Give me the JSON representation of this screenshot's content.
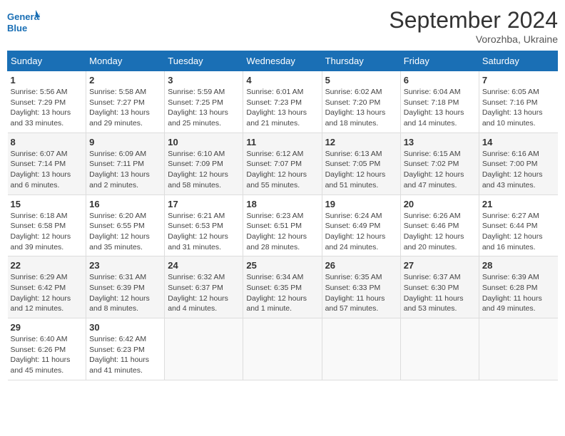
{
  "header": {
    "logo_line1": "General",
    "logo_line2": "Blue",
    "month": "September 2024",
    "location": "Vorozhba, Ukraine"
  },
  "weekdays": [
    "Sunday",
    "Monday",
    "Tuesday",
    "Wednesday",
    "Thursday",
    "Friday",
    "Saturday"
  ],
  "weeks": [
    [
      {
        "day": "1",
        "sunrise": "5:56 AM",
        "sunset": "7:29 PM",
        "daylight": "13 hours and 33 minutes."
      },
      {
        "day": "2",
        "sunrise": "5:58 AM",
        "sunset": "7:27 PM",
        "daylight": "13 hours and 29 minutes."
      },
      {
        "day": "3",
        "sunrise": "5:59 AM",
        "sunset": "7:25 PM",
        "daylight": "13 hours and 25 minutes."
      },
      {
        "day": "4",
        "sunrise": "6:01 AM",
        "sunset": "7:23 PM",
        "daylight": "13 hours and 21 minutes."
      },
      {
        "day": "5",
        "sunrise": "6:02 AM",
        "sunset": "7:20 PM",
        "daylight": "13 hours and 18 minutes."
      },
      {
        "day": "6",
        "sunrise": "6:04 AM",
        "sunset": "7:18 PM",
        "daylight": "13 hours and 14 minutes."
      },
      {
        "day": "7",
        "sunrise": "6:05 AM",
        "sunset": "7:16 PM",
        "daylight": "13 hours and 10 minutes."
      }
    ],
    [
      {
        "day": "8",
        "sunrise": "6:07 AM",
        "sunset": "7:14 PM",
        "daylight": "13 hours and 6 minutes."
      },
      {
        "day": "9",
        "sunrise": "6:09 AM",
        "sunset": "7:11 PM",
        "daylight": "13 hours and 2 minutes."
      },
      {
        "day": "10",
        "sunrise": "6:10 AM",
        "sunset": "7:09 PM",
        "daylight": "12 hours and 58 minutes."
      },
      {
        "day": "11",
        "sunrise": "6:12 AM",
        "sunset": "7:07 PM",
        "daylight": "12 hours and 55 minutes."
      },
      {
        "day": "12",
        "sunrise": "6:13 AM",
        "sunset": "7:05 PM",
        "daylight": "12 hours and 51 minutes."
      },
      {
        "day": "13",
        "sunrise": "6:15 AM",
        "sunset": "7:02 PM",
        "daylight": "12 hours and 47 minutes."
      },
      {
        "day": "14",
        "sunrise": "6:16 AM",
        "sunset": "7:00 PM",
        "daylight": "12 hours and 43 minutes."
      }
    ],
    [
      {
        "day": "15",
        "sunrise": "6:18 AM",
        "sunset": "6:58 PM",
        "daylight": "12 hours and 39 minutes."
      },
      {
        "day": "16",
        "sunrise": "6:20 AM",
        "sunset": "6:55 PM",
        "daylight": "12 hours and 35 minutes."
      },
      {
        "day": "17",
        "sunrise": "6:21 AM",
        "sunset": "6:53 PM",
        "daylight": "12 hours and 31 minutes."
      },
      {
        "day": "18",
        "sunrise": "6:23 AM",
        "sunset": "6:51 PM",
        "daylight": "12 hours and 28 minutes."
      },
      {
        "day": "19",
        "sunrise": "6:24 AM",
        "sunset": "6:49 PM",
        "daylight": "12 hours and 24 minutes."
      },
      {
        "day": "20",
        "sunrise": "6:26 AM",
        "sunset": "6:46 PM",
        "daylight": "12 hours and 20 minutes."
      },
      {
        "day": "21",
        "sunrise": "6:27 AM",
        "sunset": "6:44 PM",
        "daylight": "12 hours and 16 minutes."
      }
    ],
    [
      {
        "day": "22",
        "sunrise": "6:29 AM",
        "sunset": "6:42 PM",
        "daylight": "12 hours and 12 minutes."
      },
      {
        "day": "23",
        "sunrise": "6:31 AM",
        "sunset": "6:39 PM",
        "daylight": "12 hours and 8 minutes."
      },
      {
        "day": "24",
        "sunrise": "6:32 AM",
        "sunset": "6:37 PM",
        "daylight": "12 hours and 4 minutes."
      },
      {
        "day": "25",
        "sunrise": "6:34 AM",
        "sunset": "6:35 PM",
        "daylight": "12 hours and 1 minute."
      },
      {
        "day": "26",
        "sunrise": "6:35 AM",
        "sunset": "6:33 PM",
        "daylight": "11 hours and 57 minutes."
      },
      {
        "day": "27",
        "sunrise": "6:37 AM",
        "sunset": "6:30 PM",
        "daylight": "11 hours and 53 minutes."
      },
      {
        "day": "28",
        "sunrise": "6:39 AM",
        "sunset": "6:28 PM",
        "daylight": "11 hours and 49 minutes."
      }
    ],
    [
      {
        "day": "29",
        "sunrise": "6:40 AM",
        "sunset": "6:26 PM",
        "daylight": "11 hours and 45 minutes."
      },
      {
        "day": "30",
        "sunrise": "6:42 AM",
        "sunset": "6:23 PM",
        "daylight": "11 hours and 41 minutes."
      },
      null,
      null,
      null,
      null,
      null
    ]
  ]
}
